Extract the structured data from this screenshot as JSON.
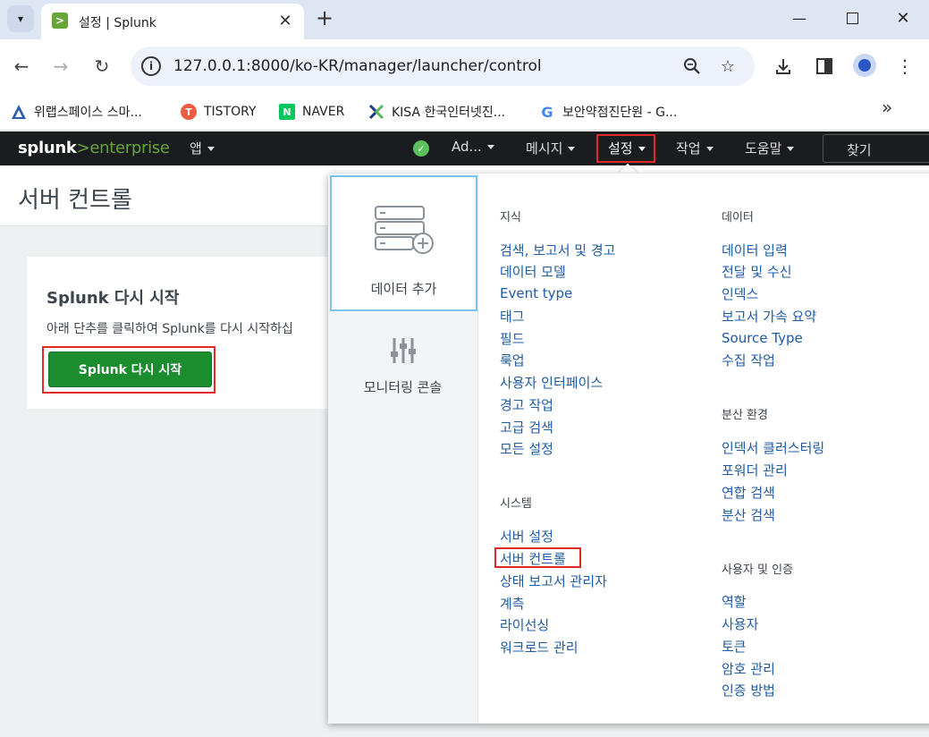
{
  "browser": {
    "tab_title": "설정 | Splunk",
    "url": "127.0.0.1:8000/ko-KR/manager/launcher/control",
    "bookmarks": [
      {
        "label": "위랩스페이스 스마...",
        "icon": "wrap-icon",
        "color": "#2a5db0"
      },
      {
        "label": "TISTORY",
        "icon": "tistory-icon",
        "color": "#ef5b3f"
      },
      {
        "label": "NAVER",
        "icon": "naver-icon",
        "color": "#03c75a"
      },
      {
        "label": "KISA 한국인터넷진...",
        "icon": "kisa-icon",
        "color": "#1b3a8a"
      },
      {
        "label": "보안약점진단원 - G...",
        "icon": "google-icon",
        "color": "#4285f4"
      }
    ]
  },
  "splunk": {
    "logo_main": "splunk",
    "logo_sub": ">enterprise",
    "nav": {
      "apps": "앱",
      "admin": "Ad...",
      "messages": "메시지",
      "settings": "설정",
      "activity": "작업",
      "help": "도움말",
      "find": "찾기"
    }
  },
  "page": {
    "title": "서버 컨트롤",
    "panel_title": "Splunk 다시 시작",
    "panel_desc": "아래 단추를 클릭하여 Splunk를 다시 시작하십",
    "restart_button": "Splunk 다시 시작"
  },
  "menu": {
    "tiles": {
      "add_data": "데이터 추가",
      "monitoring_console": "모니터링 콘솔"
    },
    "knowledge": {
      "heading": "지식",
      "items": [
        "검색, 보고서 및 경고",
        "데이터 모델",
        "Event type",
        "태그",
        "필드",
        "룩업",
        "사용자 인터페이스",
        "경고 작업",
        "고급 검색",
        "모든 설정"
      ]
    },
    "system": {
      "heading": "시스템",
      "items": [
        "서버 설정",
        "서버 컨트롤",
        "상태 보고서 관리자",
        "계측",
        "라이선싱",
        "워크로드 관리"
      ]
    },
    "data": {
      "heading": "데이터",
      "items": [
        "데이터 입력",
        "전달 및 수신",
        "인덱스",
        "보고서 가속 요약",
        "Source Type",
        "수집 작업"
      ]
    },
    "distributed": {
      "heading": "분산 환경",
      "items": [
        "인덱서 클러스터링",
        "포워더 관리",
        "연합 검색",
        "분산 검색"
      ]
    },
    "users": {
      "heading": "사용자 및 인증",
      "items": [
        "역할",
        "사용자",
        "토큰",
        "암호 관리",
        "인증 방법"
      ]
    }
  },
  "colors": {
    "splunk_green": "#65a637",
    "link_blue": "#1e5ca8",
    "highlight_red": "#e02a2a"
  }
}
